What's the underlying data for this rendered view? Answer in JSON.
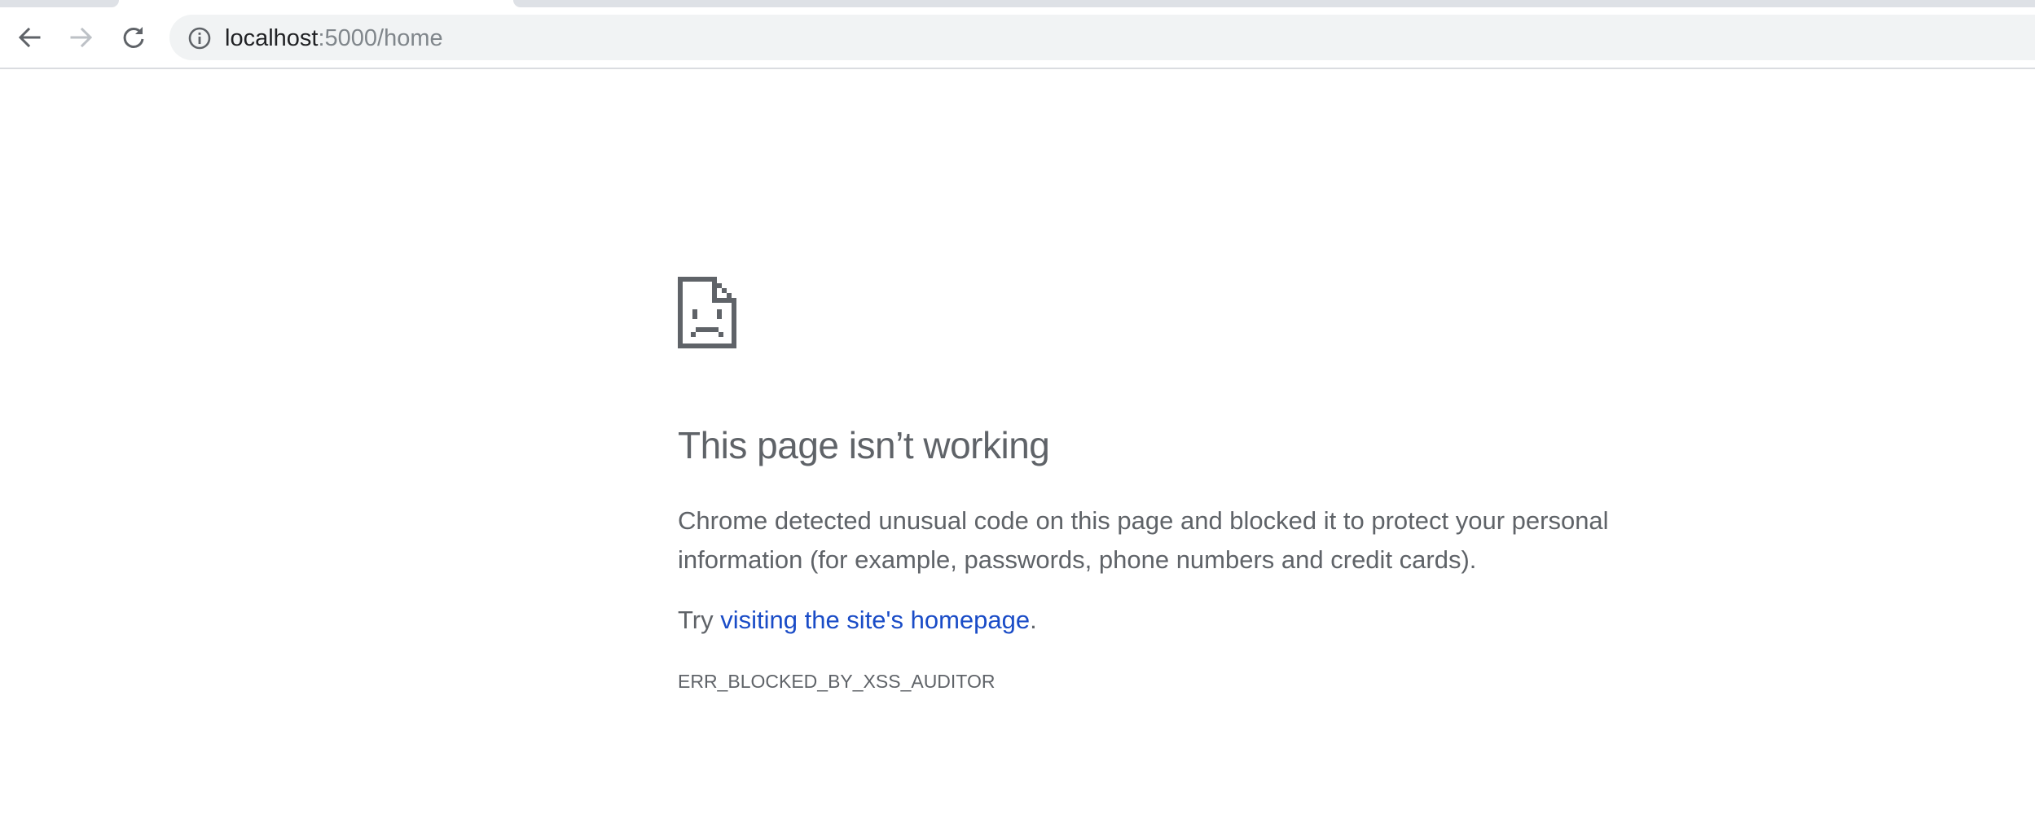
{
  "browser": {
    "url_host": "localhost",
    "url_rest": ":5000/home",
    "icons": {
      "back": "arrow-left",
      "forward": "arrow-right",
      "reload": "reload",
      "site_info": "info-circle"
    }
  },
  "error_page": {
    "icon": "sad-file",
    "title": "This page isn’t working",
    "description": "Chrome detected unusual code on this page and blocked it to protect your personal information (for example, passwords, phone numbers and credit cards).",
    "suggestion_prefix": "Try ",
    "suggestion_link": "visiting the site's homepage",
    "suggestion_suffix": ".",
    "error_code": "ERR_BLOCKED_BY_XSS_AUDITOR",
    "colors": {
      "text": "#5f6368",
      "link": "#1a4cc7"
    }
  }
}
